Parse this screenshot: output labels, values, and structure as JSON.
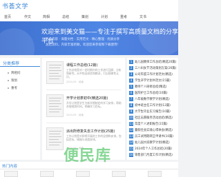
{
  "header": {
    "logo_text": "书荟文学"
  },
  "nav": [
    "首页",
    "作文",
    "简相",
    "总结",
    "策划",
    "计划",
    "重考",
    "文书"
  ],
  "hero": {
    "title": "欢迎来到美文猫——专注于撰写高质量文档的分享平台",
    "line1": "更多内容 · 海量文档 · 实用范文 · 精心整理 · 优质分享",
    "line2": "总结资料，内容丰富新颖，欢迎您来参观和下载使用！"
  },
  "sidebar": {
    "title": "分类推荐",
    "items": [
      "简相问",
      "策划",
      "重考"
    ]
  },
  "articles": [
    {
      "title": "课程工作总结(12篇)",
      "desc": "工作总结是对一定时期内的工作进行回顾、分析和研究，从中找出经验和教训，引出规律性认识。",
      "meta": "2024-05 · 阅读"
    },
    {
      "title": "开学计划表初中(精选20篇)",
      "desc": "开学计划是学生为新学期制定的学习安排，帮助合理规划时间，明确学习目标。",
      "meta": "2024-05 · 阅读"
    },
    {
      "title": "派出所修复失去工作计划(25篇)",
      "desc": "工作计划是对即将开展的工作的设想和安排，包括目标、措施与进度安排。",
      "meta": "2024-05 · 阅读"
    }
  ],
  "ranking": [
    "幼儿园教师工作总结(精选20篇)",
    "三八妇女节活动策划方案(20篇)",
    "公司年度工作计划范文(精选)",
    "学生开学计划书范文(15篇)",
    "教师个人研修总结(精选)",
    "医院护士工作总结(10篇)",
    "八年级数学教学计划(精选)",
    "初中班主任工作计划(12篇)",
    "大学生毕业实习报告(10篇)",
    "社区志愿服务活动总结(精选)",
    "年度个人述职报告(15篇)",
    "暑假社会实践心得体会(精选)",
    "员工试用期转正申请书(10篇)",
    "幼儿园大班教学计划(精选)",
    "2024年个人工作总结(20篇)",
    "销售部门月度工作计划(精选)"
  ],
  "bottom": {
    "title": "热门内容"
  },
  "watermark": "便民库"
}
